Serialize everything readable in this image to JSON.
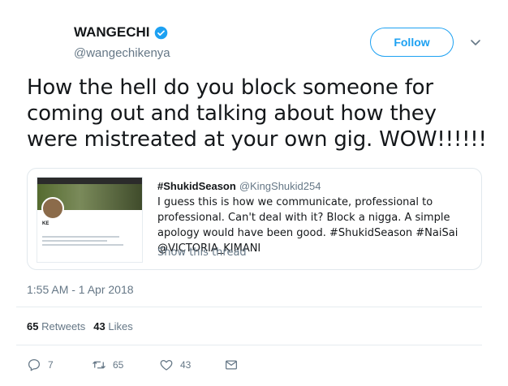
{
  "tweet": {
    "author_name": "WANGECHI",
    "author_handle": "@wangechikenya",
    "follow_label": "Follow",
    "text": "How the hell do you block someone for coming out and talking about how they were mistreated at your own gig. WOW!!!!!!",
    "timestamp": "1:55 AM - 1 Apr 2018"
  },
  "quote": {
    "author_name": "#ShukidSeason",
    "author_handle": "@KingShukid254",
    "text": "I guess this is how we communicate, professional to professional. Can't deal with it? Block a nigga. A simple apology would have been good. #ShukidSeason #NaiSai @VICTORIA_KIMANI",
    "show_thread": "Show this thread",
    "thumb_name": "KE"
  },
  "stats": {
    "retweets_count": "65",
    "retweets_label": "Retweets",
    "likes_count": "43",
    "likes_label": "Likes"
  },
  "actions": {
    "reply_count": "7",
    "retweet_count": "65",
    "like_count": "43"
  },
  "colors": {
    "accent": "#1da1f2",
    "secondary_text": "#657786",
    "border": "#e6ecf0"
  }
}
